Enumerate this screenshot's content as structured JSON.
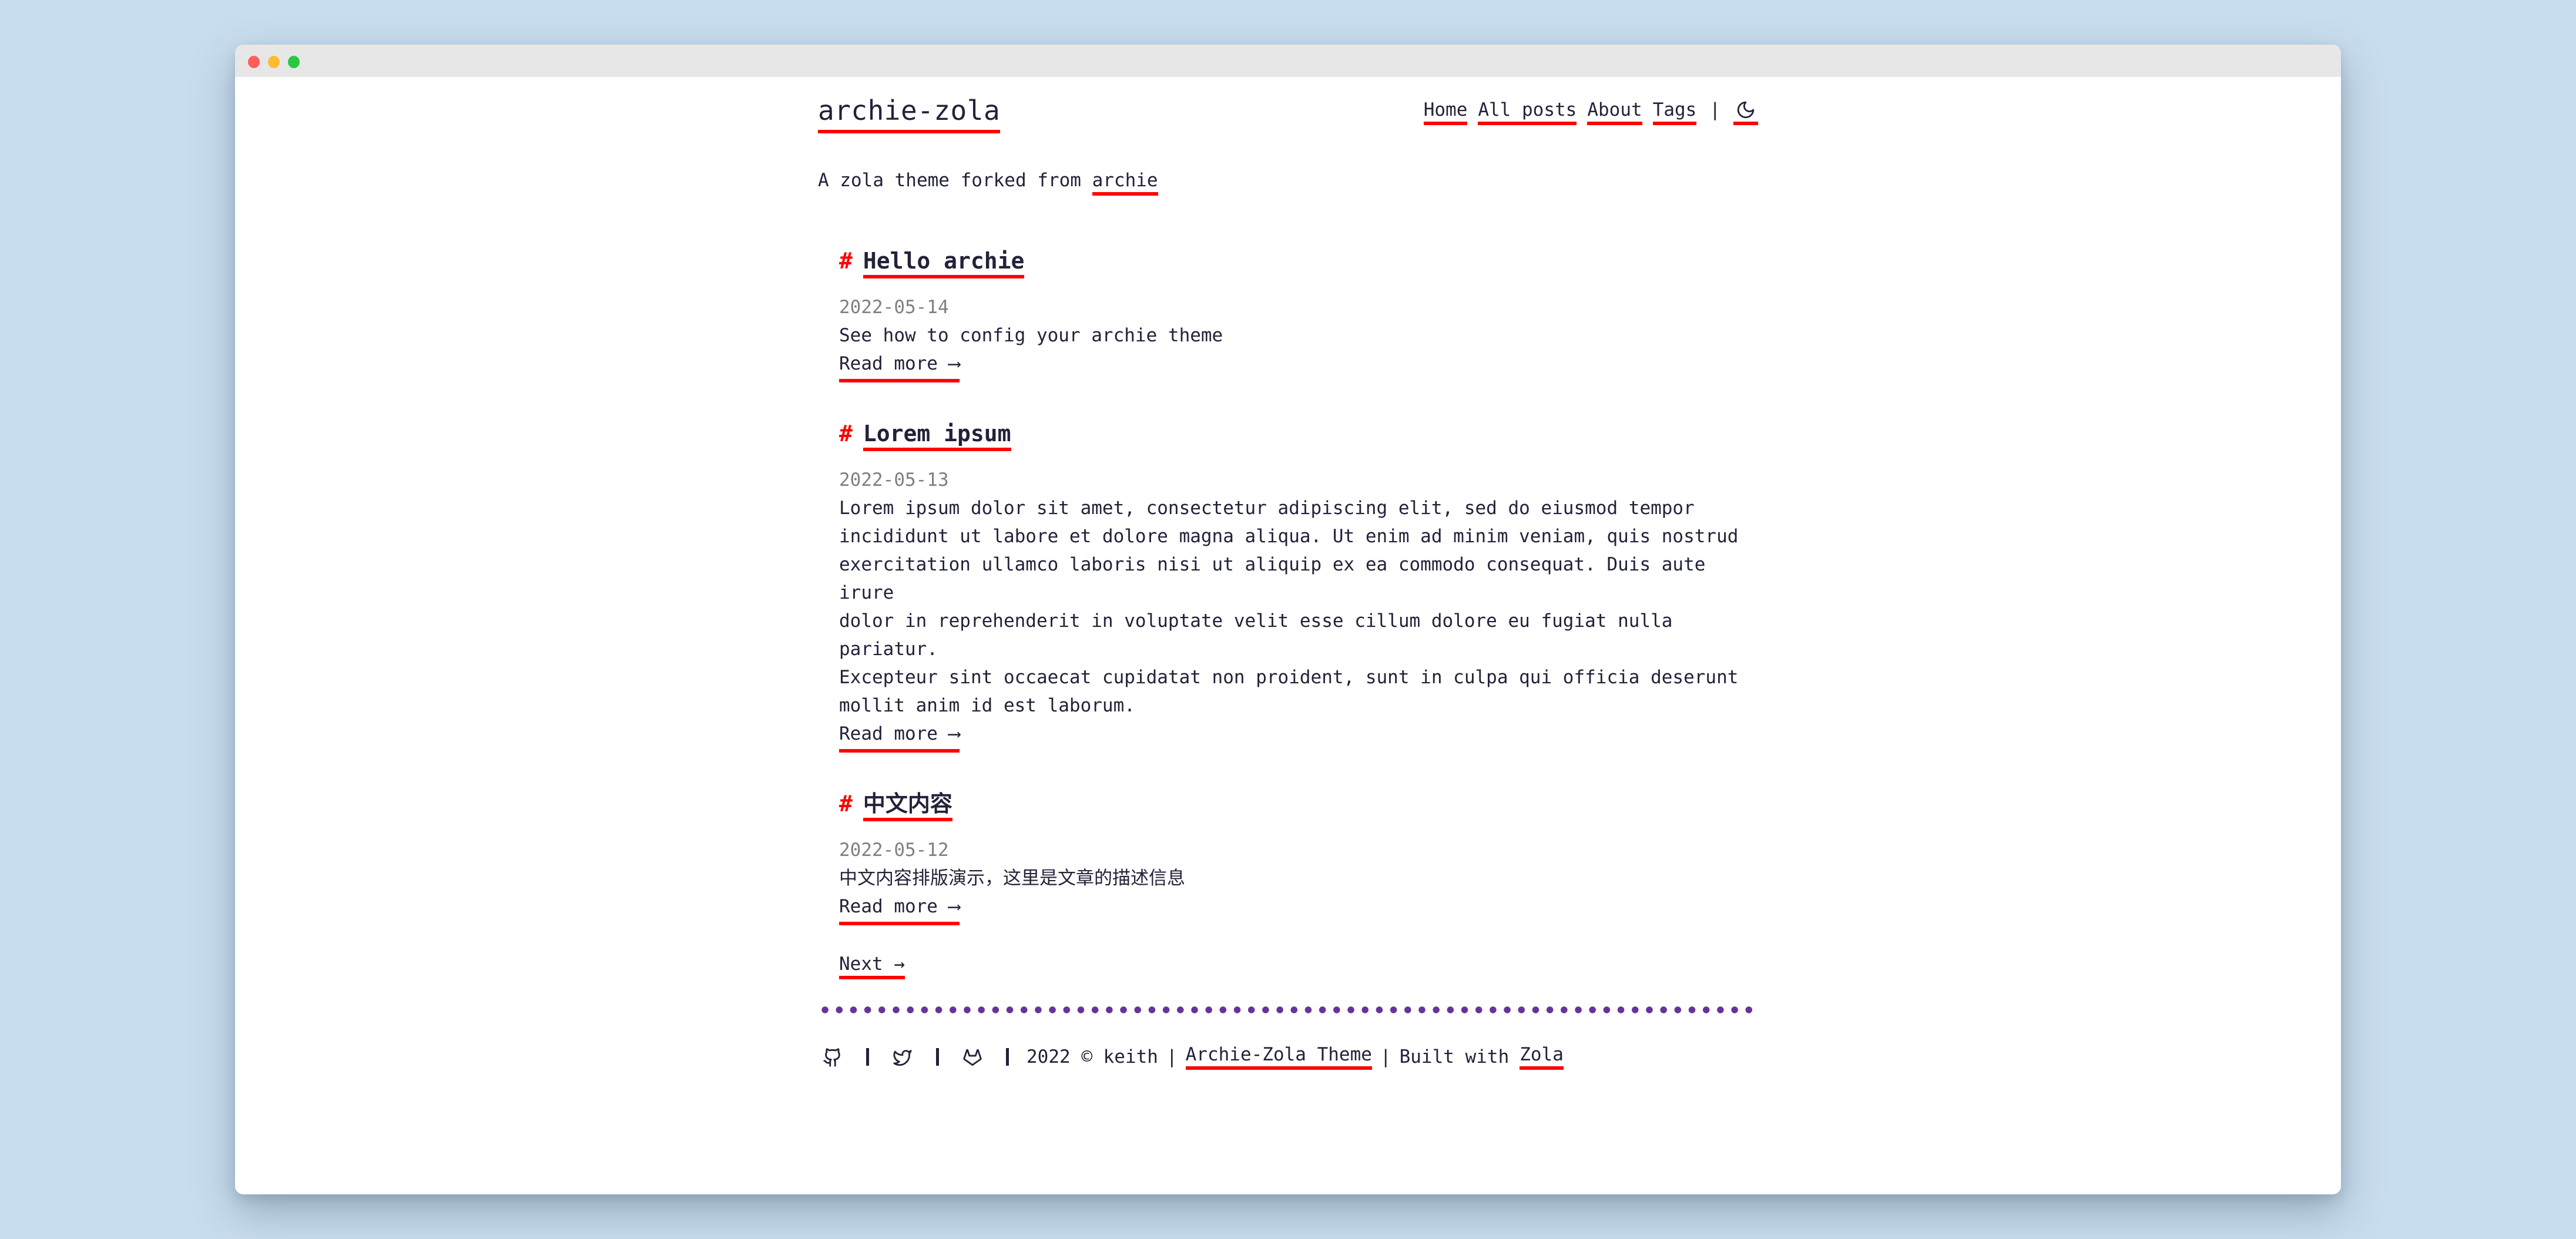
{
  "window": {
    "controls": [
      "close",
      "minimize",
      "maximize"
    ]
  },
  "header": {
    "site_title": "archie-zola",
    "nav": [
      {
        "label": "Home"
      },
      {
        "label": "All posts"
      },
      {
        "label": "About"
      },
      {
        "label": "Tags"
      }
    ],
    "nav_separator": "|",
    "theme_toggle_icon": "moon-icon"
  },
  "tagline": {
    "prefix": "A zola theme forked from ",
    "link": "archie"
  },
  "posts": [
    {
      "hash": "#",
      "title": "Hello archie",
      "date": "2022-05-14",
      "description": "See how to config your archie theme",
      "read_more": "Read more ⟶"
    },
    {
      "hash": "#",
      "title": "Lorem ipsum",
      "date": "2022-05-13",
      "description": "Lorem ipsum dolor sit amet, consectetur adipiscing elit, sed do eiusmod tempor\nincididunt ut labore et dolore magna aliqua. Ut enim ad minim veniam, quis nostrud\nexercitation ullamco laboris nisi ut aliquip ex ea commodo consequat. Duis aute irure\ndolor in reprehenderit in voluptate velit esse cillum dolore eu fugiat nulla pariatur.\nExcepteur sint occaecat cupidatat non proident, sunt in culpa qui officia deserunt\nmollit anim id est laborum.",
      "read_more": "Read more ⟶"
    },
    {
      "hash": "#",
      "title": "中文内容",
      "date": "2022-05-12",
      "description": "中文内容排版演示，这里是文章的描述信息",
      "read_more": "Read more ⟶"
    }
  ],
  "pagination": {
    "next": "Next →"
  },
  "footer": {
    "icons": [
      "github-icon",
      "twitter-icon",
      "gitlab-icon"
    ],
    "copyright": "2022 © keith",
    "separator": "|",
    "theme_link": "Archie-Zola Theme",
    "built_with": "Built with",
    "zola_link": "Zola"
  },
  "colors": {
    "accent_underline": "#ff0000",
    "hash": "#ff0000",
    "divider_dots": "#663399",
    "text": "#22223a",
    "date": "#808080",
    "page_bg": "#c8ddee"
  }
}
